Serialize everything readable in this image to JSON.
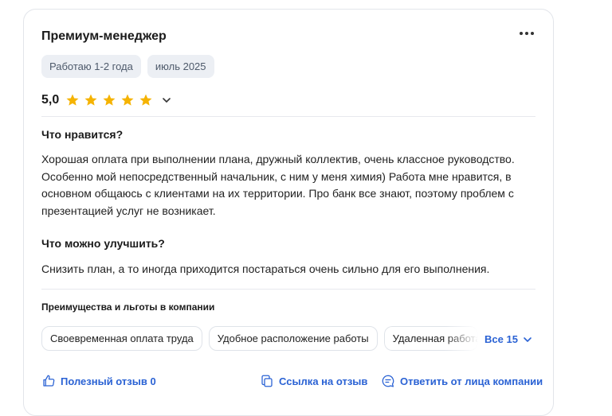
{
  "review": {
    "title": "Премиум-менеджер",
    "tags": [
      "Работаю 1-2 года",
      "июль 2025"
    ],
    "rating": "5,0",
    "stars": 5,
    "likes_heading": "Что нравится?",
    "likes_text": "Хорошая оплата при выполнении плана, дружный коллектив, очень классное руководство. Особенно мой непосредственный начальник, с ним у меня химия) Работа мне нравится, в основном общаюсь с клиентами на их территории. Про банк все знают, поэтому проблем с презентацией услуг не возникает.",
    "improve_heading": "Что можно улучшить?",
    "improve_text": "Снизить план, а то иногда приходится постараться очень сильно для его выполнения."
  },
  "benefits": {
    "heading": "Преимущества и льготы в компании",
    "items": [
      "Своевременная оплата труда",
      "Удобное расположение работы",
      "Удаленная работа"
    ],
    "all_label": "Все 15"
  },
  "actions": {
    "helpful": "Полезный отзыв 0",
    "link": "Ссылка на отзыв",
    "reply": "Ответить от лица компании"
  },
  "colors": {
    "accent": "#2a62d4",
    "star": "#f5b301",
    "tag_bg": "#eceff4"
  },
  "icons": [
    "more-icon",
    "star-icon",
    "chevron-down-icon",
    "thumbs-up-icon",
    "copy-link-icon",
    "reply-icon"
  ]
}
